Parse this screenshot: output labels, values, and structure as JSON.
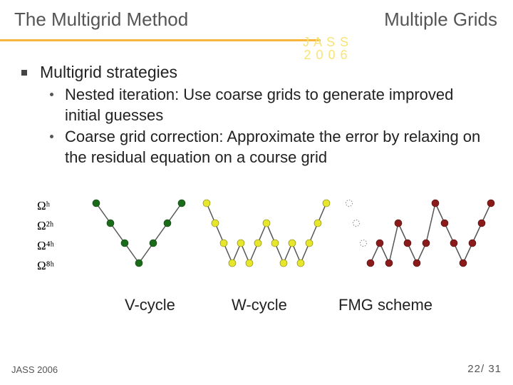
{
  "header": {
    "title_left": "The Multigrid Method",
    "title_right": "Multiple Grids",
    "watermark": "J A S S\n2 0 0 6"
  },
  "bullets": {
    "main": "Multigrid strategies",
    "subs": [
      "Nested iteration: Use coarse grids to generate improved initial guesses",
      "Coarse grid correction: Approximate the error by relaxing on the residual equation on a course grid"
    ]
  },
  "grid_labels": [
    "Ωʰ",
    "Ω²ʰ",
    "Ω⁴ʰ",
    "Ω⁸ʰ"
  ],
  "captions": {
    "v": "V-cycle",
    "w": "W-cycle",
    "f": "FMG scheme"
  },
  "footer": {
    "conf": "JASS 2006",
    "page_current": "22",
    "page_sep": "/",
    "page_total": "31"
  },
  "chart_data": [
    {
      "type": "line",
      "name": "V-cycle",
      "levels": [
        "Ω^h",
        "Ω^2h",
        "Ω^4h",
        "Ω^8h"
      ],
      "node_levels": [
        0,
        1,
        2,
        3,
        2,
        1,
        0
      ],
      "color": "#1a6b1a"
    },
    {
      "type": "line",
      "name": "W-cycle",
      "levels": [
        "Ω^h",
        "Ω^2h",
        "Ω^4h",
        "Ω^8h"
      ],
      "node_levels": [
        0,
        1,
        2,
        3,
        2,
        3,
        2,
        1,
        2,
        3,
        2,
        3,
        2,
        1,
        0
      ],
      "color": "#c9c900"
    },
    {
      "type": "line",
      "name": "FMG scheme",
      "levels": [
        "Ω^h",
        "Ω^2h",
        "Ω^4h",
        "Ω^8h"
      ],
      "start_levels": [
        0,
        1,
        2
      ],
      "node_levels": [
        3,
        2,
        3,
        1,
        2,
        3,
        2,
        0,
        1,
        2,
        3,
        2,
        1,
        0
      ],
      "color": "#8b1a1a"
    }
  ]
}
